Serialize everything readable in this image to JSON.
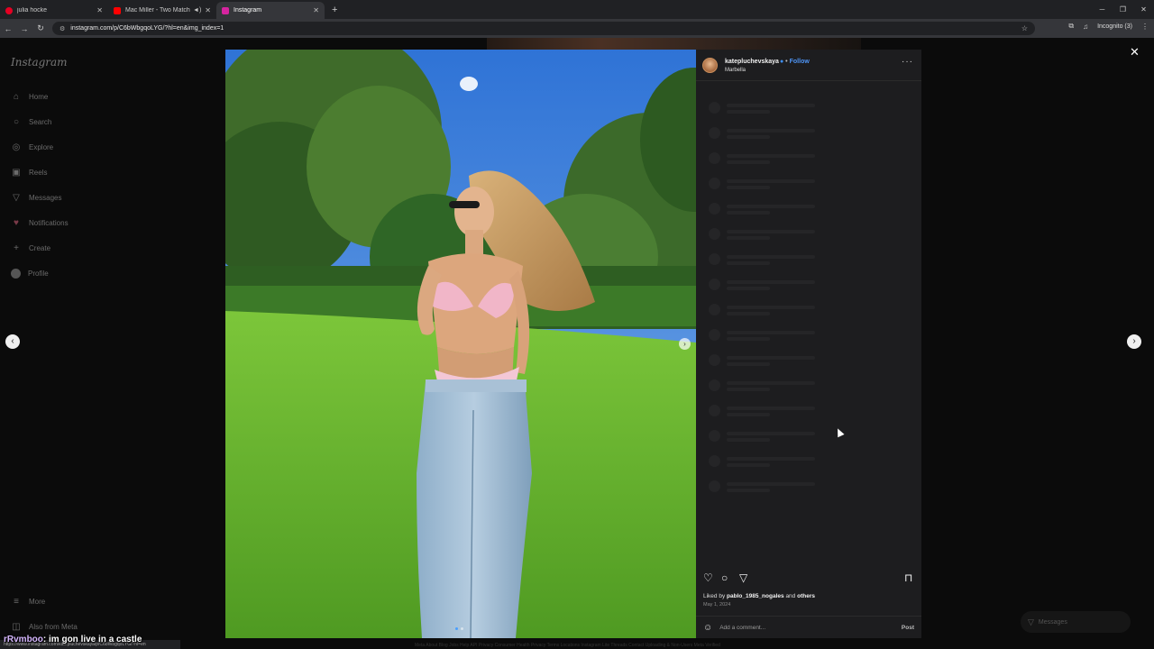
{
  "browser": {
    "tabs": [
      {
        "title": "julia hocke",
        "color": "#e60023"
      },
      {
        "title": "Mac Miller - Two Matches",
        "color": "#ff0000"
      },
      {
        "title": "Instagram",
        "color": "#d6249f"
      }
    ],
    "new_tab": "+",
    "url": "instagram.com/p/C6bWbgqoLYG/?hl=en&img_index=1",
    "incognito_label": "Incognito (3)"
  },
  "sidebar": {
    "logo": "Instagram",
    "items": [
      {
        "label": "Home",
        "icon": "home-icon",
        "glyph": "⌂"
      },
      {
        "label": "Search",
        "icon": "search-icon",
        "glyph": "○"
      },
      {
        "label": "Explore",
        "icon": "compass-icon",
        "glyph": "◎"
      },
      {
        "label": "Reels",
        "icon": "reels-icon",
        "glyph": "▣"
      },
      {
        "label": "Messages",
        "icon": "send-icon",
        "glyph": "▽"
      },
      {
        "label": "Notifications",
        "icon": "heart-icon",
        "glyph": "♥"
      },
      {
        "label": "Create",
        "icon": "plus-icon",
        "glyph": "+"
      },
      {
        "label": "Profile",
        "icon": "avatar-icon",
        "glyph": ""
      }
    ],
    "more": "More",
    "also_from_meta": "Also from Meta"
  },
  "post": {
    "username": "katepluchevskaya",
    "verified": true,
    "follow_label": "Follow",
    "location": "Marbella",
    "liked_by_prefix": "Liked by",
    "liked_by_user": "pablo_1985_nogales",
    "liked_by_and": "and",
    "liked_by_others": "others",
    "date": "May 1, 2024",
    "comment_placeholder": "Add a comment...",
    "post_label": "Post"
  },
  "messages_pill": "Messages",
  "status_url": "https://www.instagram.com/katepluchevskaya/p/C6bWbgqoLYG/?hl=en",
  "chat": {
    "user": "rRvmboo",
    "message": ": im gon live in a castle"
  },
  "footer": "Meta  About  Blog  Jobs  Help  API  Privacy  Consumer Health Privacy  Terms  Locations  Instagram Lite  Threads  Contact Uploading & Non-Users  Meta Verified"
}
